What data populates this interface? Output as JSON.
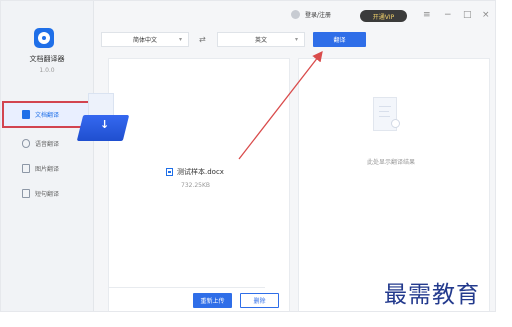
{
  "app": {
    "name": "文档翻译器",
    "version": "1.0.0"
  },
  "sidebar": {
    "items": [
      {
        "label": "文档翻译",
        "icon": "document-icon"
      },
      {
        "label": "语音翻译",
        "icon": "microphone-icon"
      },
      {
        "label": "图片翻译",
        "icon": "image-icon"
      },
      {
        "label": "短句翻译",
        "icon": "text-icon"
      }
    ]
  },
  "topbar": {
    "login_label": "登录/注册",
    "vip_label": "开通VIP",
    "menu_icon": "menu-icon",
    "minimize_icon": "minimize-icon",
    "maximize_icon": "maximize-icon",
    "close_icon": "close-icon"
  },
  "translation_bar": {
    "source_language": "简体中文",
    "target_language": "英文",
    "swap_icon": "swap-arrows-icon",
    "translate_button": "翻译"
  },
  "source_panel": {
    "file_name": "测试样本.docx",
    "file_size": "732.25KB",
    "reupload_button": "重新上传",
    "delete_button": "删除"
  },
  "result_panel": {
    "placeholder": "此处显示翻译结果"
  },
  "watermark": {
    "text": "最需教育"
  },
  "colors": {
    "accent": "#2f6ee8",
    "highlight": "#d24450",
    "vip_background": "#3b3b3b",
    "vip_text": "#f4d46c"
  }
}
